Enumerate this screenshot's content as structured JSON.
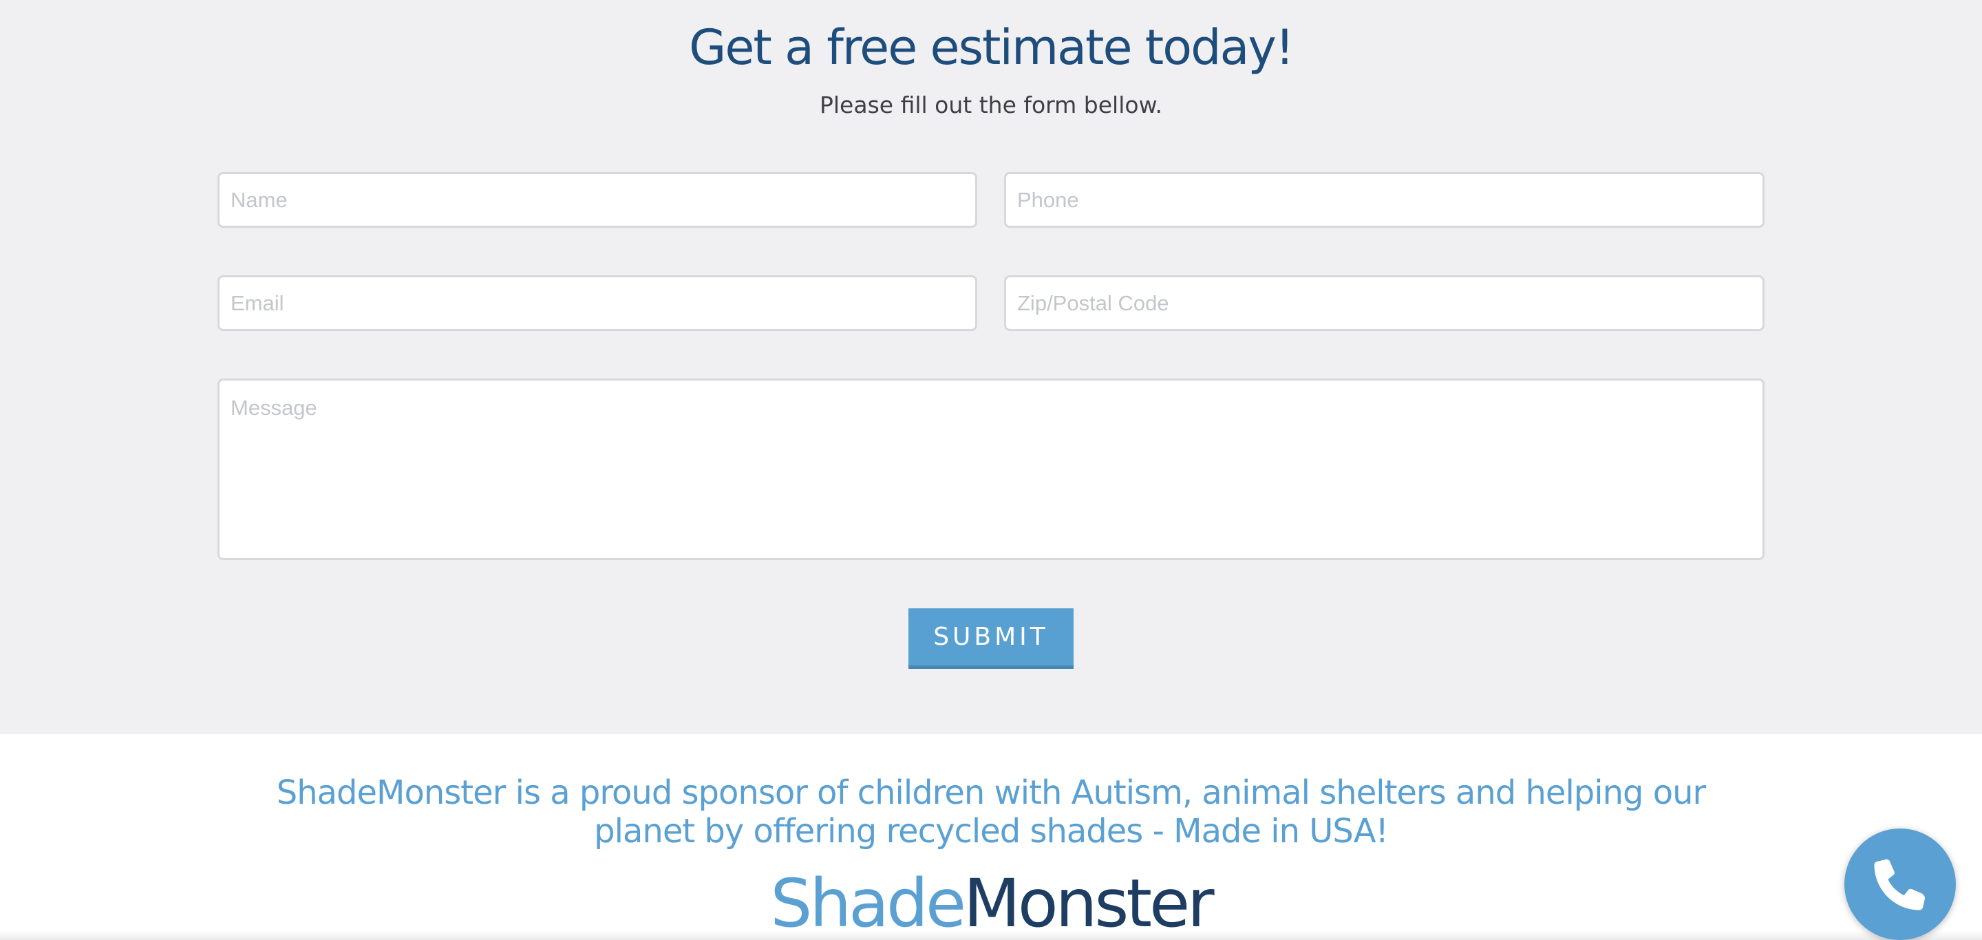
{
  "form": {
    "title": "Get a free estimate today!",
    "subtitle": "Please fill out the form bellow.",
    "fields": {
      "name_placeholder": "Name",
      "phone_placeholder": "Phone",
      "email_placeholder": "Email",
      "zip_placeholder": "Zip/Postal Code",
      "message_placeholder": "Message"
    },
    "submit_label": "SUBMIT"
  },
  "footer": {
    "sponsor_text": "ShadeMonster is a proud sponsor of children with Autism, animal shelters and helping our planet by offering recycled shades -  Made in USA!",
    "logo_part1": "Shade",
    "logo_part2": "Monster"
  },
  "call_button": {
    "icon": "phone-icon"
  },
  "colors": {
    "heading": "#1e4d7c",
    "accent": "#5aa0d2",
    "logo_dark": "#1e3d63",
    "form_background": "#f0f0f3"
  }
}
